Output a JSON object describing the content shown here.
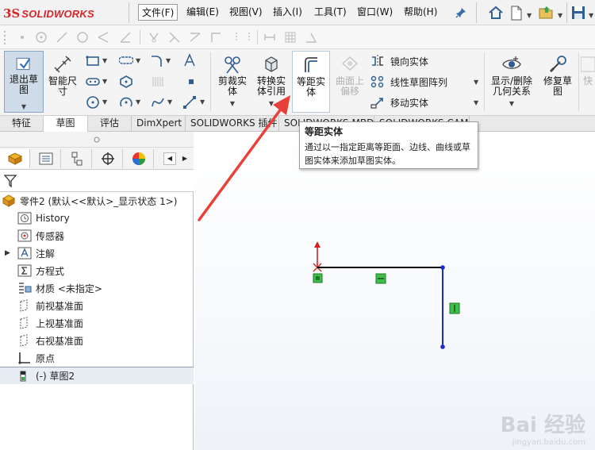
{
  "app": {
    "logo_ds": "3S",
    "logo_text": "SOLIDWORKS"
  },
  "menu": [
    {
      "label": "文件(F)"
    },
    {
      "label": "编辑(E)"
    },
    {
      "label": "视图(V)"
    },
    {
      "label": "插入(I)"
    },
    {
      "label": "工具(T)"
    },
    {
      "label": "窗口(W)"
    },
    {
      "label": "帮助(H)"
    }
  ],
  "command_manager": {
    "exit_sketch": "退出草图",
    "smart_dim": "智能尺寸",
    "trim": "剪裁实体",
    "convert": "转换实体引用",
    "offset": "等距实体",
    "surface_offset": "曲面上偏移",
    "mirror": "镜向实体",
    "linear_pattern": "线性草图阵列",
    "move": "移动实体",
    "display_delete": "显示/删除几何关系",
    "repair": "修复草图",
    "quick": "快"
  },
  "tabs": [
    "特征",
    "草图",
    "评估",
    "DimXpert",
    "SOLIDWORKS 插件",
    "SOLIDWORKS MBD",
    "SOLIDWORKS CAM"
  ],
  "tooltip": {
    "title": "等距实体",
    "body": "通过以一指定距离等距面、边线、曲线或草图实体来添加草图实体。"
  },
  "tree": {
    "root": "零件2  (默认<<默认>_显示状态 1>)",
    "items": [
      {
        "label": "History",
        "icon": "history-icon"
      },
      {
        "label": "传感器",
        "icon": "sensor-icon"
      },
      {
        "label": "注解",
        "icon": "annotation-icon"
      },
      {
        "label": "方程式",
        "icon": "equation-icon"
      },
      {
        "label": "材质 <未指定>",
        "icon": "material-icon"
      },
      {
        "label": "前视基准面",
        "icon": "plane-icon"
      },
      {
        "label": "上视基准面",
        "icon": "plane-icon"
      },
      {
        "label": "右视基准面",
        "icon": "plane-icon"
      },
      {
        "label": "原点",
        "icon": "origin-icon"
      },
      {
        "label": "(-) 草图2",
        "icon": "sketch-icon"
      }
    ]
  },
  "watermark": {
    "main": "Bai 经验",
    "sub": "jingyan.baidu.com"
  },
  "colors": {
    "accent": "#d6262b",
    "sketch_line": "#000000",
    "sketch_selected": "#1a2bd0",
    "relation_green": "#3fbf4a",
    "arrow_red": "#e8413a"
  }
}
